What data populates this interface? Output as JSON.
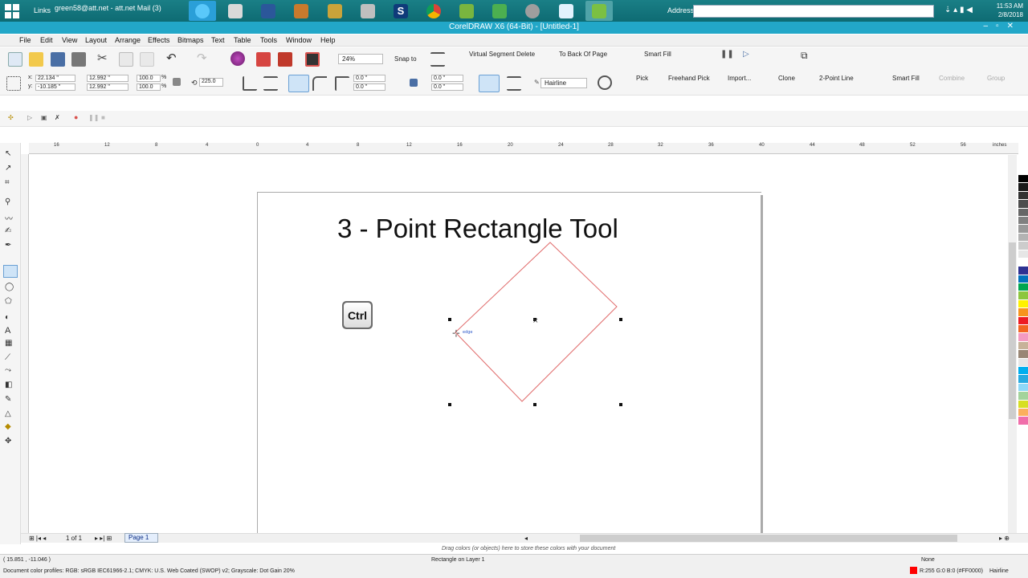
{
  "taskbar": {
    "links": "Links",
    "mail_tab": "green58@att.net - att.net Mail (3)",
    "address_label": "Address",
    "clock_time": "11:53 AM",
    "clock_date": "2/8/2018",
    "icons": [
      "ie-icon",
      "calendar-icon",
      "word-icon",
      "app-icon",
      "pen-icon",
      "scanner-icon",
      "s-app-icon",
      "chrome-icon",
      "corel-icon",
      "leaf-icon",
      "globe-icon",
      "document-icon",
      "coreldraw-active-icon"
    ]
  },
  "window": {
    "title": "CorelDRAW X6 (64-Bit) - [Untitled-1]"
  },
  "menu": {
    "items": [
      "File",
      "Edit",
      "View",
      "Layout",
      "Arrange",
      "Effects",
      "Bitmaps",
      "Text",
      "Table",
      "Tools",
      "Window",
      "Help"
    ]
  },
  "toolbar": {
    "zoom": "24%",
    "snap_to": "Snap to",
    "virtual_segment_delete": "Virtual Segment Delete",
    "to_back_of_page": "To Back Of Page",
    "smart_fill": "Smart Fill"
  },
  "property_bar": {
    "x": "22.134 \"",
    "y": "-10.185 \"",
    "width": "12.992 \"",
    "height": "12.992 \"",
    "scale_x": "100.0",
    "scale_y": "100.0",
    "percent": "%",
    "rotation": "225.0",
    "corner1": "0.0 \"",
    "corner2": "0.0 \"",
    "corner3": "0.0 \"",
    "corner4": "0.0 \"",
    "outline": "Hairline",
    "pick": "Pick",
    "freehand_pick": "Freehand Pick",
    "import": "Import...",
    "clone": "Clone",
    "two_point_line": "2-Point Line",
    "smart_fill": "Smart Fill",
    "combine": "Combine",
    "group": "Group"
  },
  "ruler": {
    "ticks": [
      "16",
      "12",
      "8",
      "4",
      "0",
      "4",
      "8",
      "12",
      "16",
      "20",
      "24",
      "28",
      "32",
      "36",
      "40",
      "44",
      "48",
      "52",
      "56"
    ],
    "unit": "inches"
  },
  "canvas": {
    "heading": "3 - Point Rectangle Tool",
    "key_label": "Ctrl",
    "cursor_label": "edge"
  },
  "page_nav": {
    "page_count": "1 of 1",
    "page_tab": "Page 1",
    "drag_hint": "Drag colors (or objects) here to store these colors with your document"
  },
  "status": {
    "coords": "( 15.851 , -11.046 )",
    "selection": "Rectangle on Layer 1",
    "fill": "None",
    "outline_color": "R:255 G:0 B:0 (#FF0000)",
    "outline_width": "Hairline",
    "color_profiles": "Document color profiles: RGB: sRGB IEC61966-2.1; CMYK: U.S. Web Coated (SWOP) v2; Grayscale: Dot Gain 20%"
  },
  "palette": [
    "#000000",
    "#1a1a1a",
    "#333333",
    "#4d4d4d",
    "#666666",
    "#808080",
    "#999999",
    "#b3b3b3",
    "#cccccc",
    "#e6e6e6",
    "#ffffff",
    "#2e3192",
    "#0072bc",
    "#00a651",
    "#8dc63f",
    "#fff200",
    "#f7941d",
    "#ed1c24",
    "#f26522",
    "#f49ac1",
    "#c7b299",
    "#998675",
    "#e6e6e6",
    "#00aeef",
    "#27aae1",
    "#8ed8f8",
    "#a3d39c",
    "#d7df23",
    "#fbaf5d",
    "#f06eaa",
    "#ffffff",
    "#ffffff",
    "#ffffff",
    "#ffffff",
    "#ffffff",
    "#ffffff",
    "#ffffff",
    "#ffffff",
    "#ffffff",
    "#ffffff",
    "#ffffff",
    "#ffffff"
  ]
}
